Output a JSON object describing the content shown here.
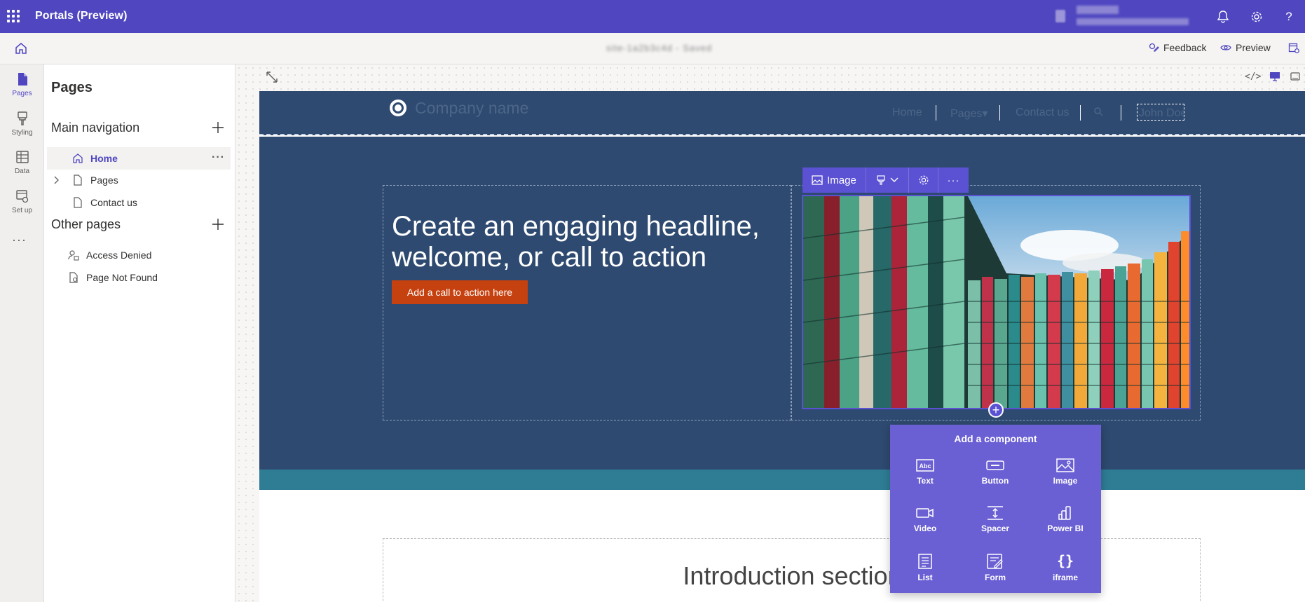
{
  "app": {
    "title": "Portals (Preview)",
    "env_name": "contoso",
    "env_org": "Dynamics 365 environment"
  },
  "commandbar": {
    "site_url": "site-1a2b3c4d - Saved",
    "feedback": "Feedback",
    "preview": "Preview"
  },
  "rail": [
    {
      "label": "Pages",
      "icon": "page-icon",
      "active": true
    },
    {
      "label": "Styling",
      "icon": "paintbrush-icon",
      "active": false
    },
    {
      "label": "Data",
      "icon": "table-icon",
      "active": false
    },
    {
      "label": "Set up",
      "icon": "setup-icon",
      "active": false
    }
  ],
  "panel": {
    "title": "Pages",
    "main_nav_title": "Main navigation",
    "main_nav": [
      {
        "label": "Home",
        "icon": "home-icon",
        "selected": true
      },
      {
        "label": "Pages",
        "icon": "page-icon",
        "expandable": true
      },
      {
        "label": "Contact us",
        "icon": "page-icon"
      }
    ],
    "other_title": "Other pages",
    "other": [
      {
        "label": "Access Denied",
        "icon": "person-lock-icon"
      },
      {
        "label": "Page Not Found",
        "icon": "page-search-icon"
      }
    ]
  },
  "site": {
    "company_name": "Company name",
    "nav": [
      "Home",
      "Pages▾",
      "Contact us",
      "John Doe▾"
    ],
    "headline": "Create an engaging headline, welcome, or call to action",
    "cta_label": "Add a call to action here",
    "intro_title": "Introduction section"
  },
  "image_toolbar": {
    "label": "Image"
  },
  "add_component": {
    "title": "Add a component",
    "items": [
      {
        "label": "Text",
        "icon": "text-icon"
      },
      {
        "label": "Button",
        "icon": "button-icon"
      },
      {
        "label": "Image",
        "icon": "image-icon"
      },
      {
        "label": "Video",
        "icon": "video-icon"
      },
      {
        "label": "Spacer",
        "icon": "spacer-icon"
      },
      {
        "label": "Power BI",
        "icon": "powerbi-icon"
      },
      {
        "label": "List",
        "icon": "list-icon"
      },
      {
        "label": "Form",
        "icon": "form-icon"
      },
      {
        "label": "iframe",
        "icon": "iframe-icon"
      }
    ]
  },
  "colors": {
    "brand": "#4f46c0",
    "hero_bg": "#2e4a70",
    "cta": "#c5410f",
    "teal": "#2e7d95",
    "popup": "#6a5fd3"
  }
}
